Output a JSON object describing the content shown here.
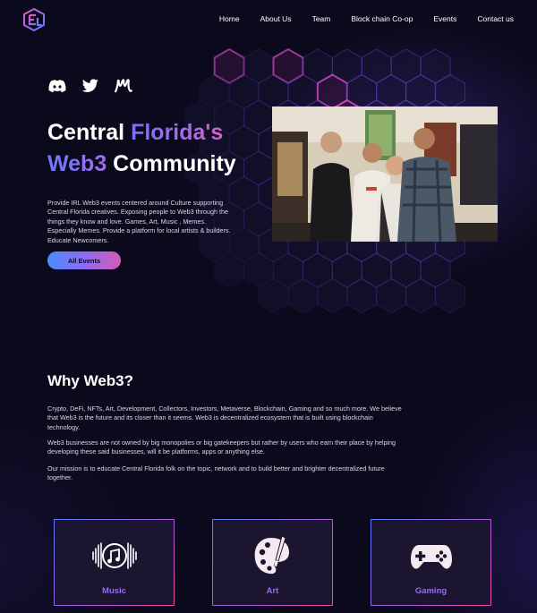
{
  "nav": {
    "items": [
      "Home",
      "About Us",
      "Team",
      "Block chain Co-op",
      "Events",
      "Contact us"
    ]
  },
  "social": [
    "discord-icon",
    "twitter-icon",
    "medium-icon"
  ],
  "hero": {
    "title_part1": "Central ",
    "title_part2": "Florida's",
    "title_part3": "Web3",
    "title_part4": " Community",
    "description": "Provide IRL Web3 events centered around Culture supporting Central Florida creatives. Exposing people to Web3 through the things they know and love. Games, Art, Music , Memes. Especially Memes. Provide a platform for local artists & builders. Educate Newcomers.",
    "button_label": "All Events"
  },
  "why": {
    "title": "Why Web3?",
    "paragraphs": [
      "Crypto, DeFi, NFTs, Art, Development, Collectors, Investors, Metaverse, Blockchain, Gaming and so much more. We believe that Web3 is the future and its closer than it seems. Web3 is decentralized ecosystem that is built using blockchain technology.",
      "Web3 businesses are not owned by big monopolies or big gatekeepers but rather by users who earn their place by helping developing these said businesses, will it be platforms, apps or anything else.",
      "Our mission is to educate Central Florida folk on the topic, network and to build better and brighter decentralized future together."
    ]
  },
  "cards": [
    {
      "label": "Music",
      "icon": "music-icon"
    },
    {
      "label": "Art",
      "icon": "art-palette-icon"
    },
    {
      "label": "Gaming",
      "icon": "gamepad-icon"
    }
  ],
  "colors": {
    "background": "#0b0a1c",
    "accent_blue": "#5a7bff",
    "accent_purple": "#b05be0",
    "accent_pink": "#ee4aa6"
  }
}
